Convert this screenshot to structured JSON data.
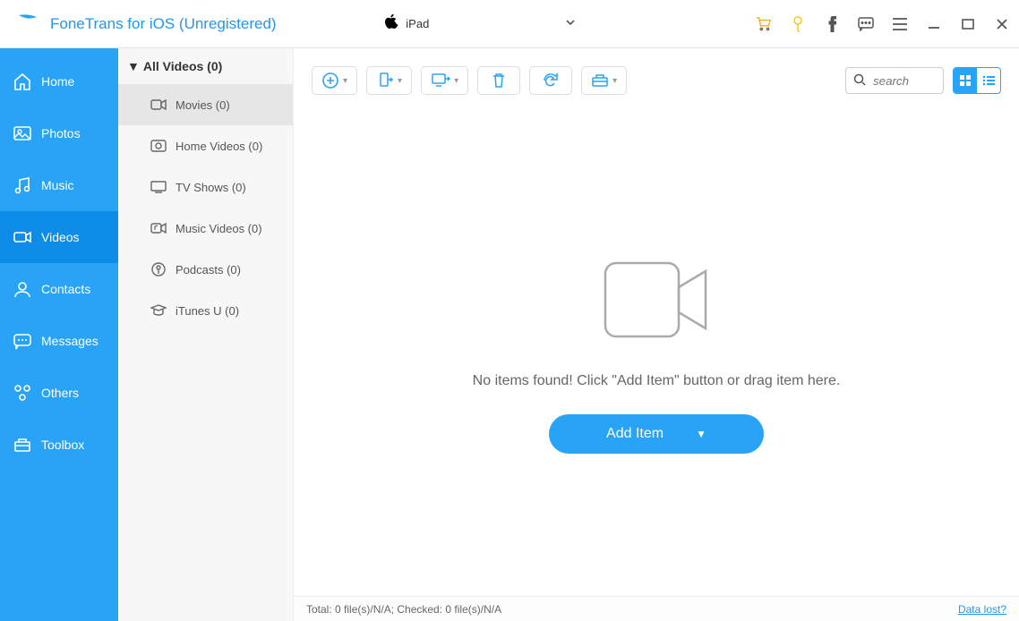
{
  "header": {
    "app_title": "FoneTrans for iOS (Unregistered)",
    "device_name": "iPad"
  },
  "sidebar": {
    "items": [
      {
        "label": "Home"
      },
      {
        "label": "Photos"
      },
      {
        "label": "Music"
      },
      {
        "label": "Videos"
      },
      {
        "label": "Contacts"
      },
      {
        "label": "Messages"
      },
      {
        "label": "Others"
      },
      {
        "label": "Toolbox"
      }
    ]
  },
  "subnav": {
    "header": "All Videos (0)",
    "items": [
      {
        "label": "Movies (0)"
      },
      {
        "label": "Home Videos (0)"
      },
      {
        "label": "TV Shows (0)"
      },
      {
        "label": "Music Videos (0)"
      },
      {
        "label": "Podcasts (0)"
      },
      {
        "label": "iTunes U (0)"
      }
    ]
  },
  "toolbar": {
    "search_placeholder": "search"
  },
  "empty": {
    "message": "No items found! Click \"Add Item\" button or drag item here.",
    "button": "Add Item"
  },
  "status": {
    "text": "Total: 0 file(s)/N/A; Checked: 0 file(s)/N/A",
    "link": "Data lost?"
  }
}
